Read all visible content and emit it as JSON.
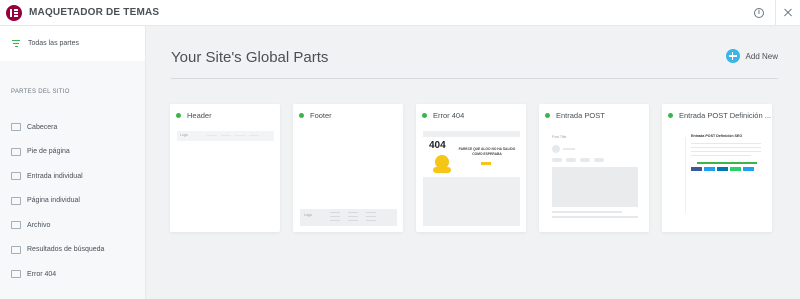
{
  "app": {
    "title": "MAQUETADOR DE TEMAS"
  },
  "top_icons": {
    "info": "info-icon",
    "close": "close-icon"
  },
  "sidebar": {
    "all_parts_label": "Todas las partes",
    "section_title": "PARTES DEL SITIO",
    "items": [
      {
        "label": "Cabecera",
        "icon": "header-icon"
      },
      {
        "label": "Pie de página",
        "icon": "footer-icon"
      },
      {
        "label": "Entrada individual",
        "icon": "single-post-icon"
      },
      {
        "label": "Página individual",
        "icon": "single-page-icon"
      },
      {
        "label": "Archivo",
        "icon": "archive-icon"
      },
      {
        "label": "Resultados de búsqueda",
        "icon": "search-results-icon"
      },
      {
        "label": "Error 404",
        "icon": "error-404-icon"
      }
    ]
  },
  "main": {
    "title": "Your Site's Global Parts",
    "add_new": "Add New",
    "cards": [
      {
        "title": "Header",
        "status_color": "#39b54a",
        "thumb_text": "Logo"
      },
      {
        "title": "Footer",
        "status_color": "#39b54a",
        "thumb_text": "Logo"
      },
      {
        "title": "Error 404",
        "status_color": "#39b54a",
        "thumb_text": "404",
        "thumb_caption": "PARECE QUE ALGO NO HA SALIDO COMO ESPERABA"
      },
      {
        "title": "Entrada POST",
        "status_color": "#39b54a",
        "thumb_text": "Post Title"
      },
      {
        "title": "Entrada POST Definición ...",
        "status_color": "#39b54a",
        "thumb_text": "Entrada POST Definición SEO"
      }
    ]
  },
  "colors": {
    "accent": "#39b5e8",
    "brand": "#93003c",
    "status_green": "#39b54a"
  }
}
